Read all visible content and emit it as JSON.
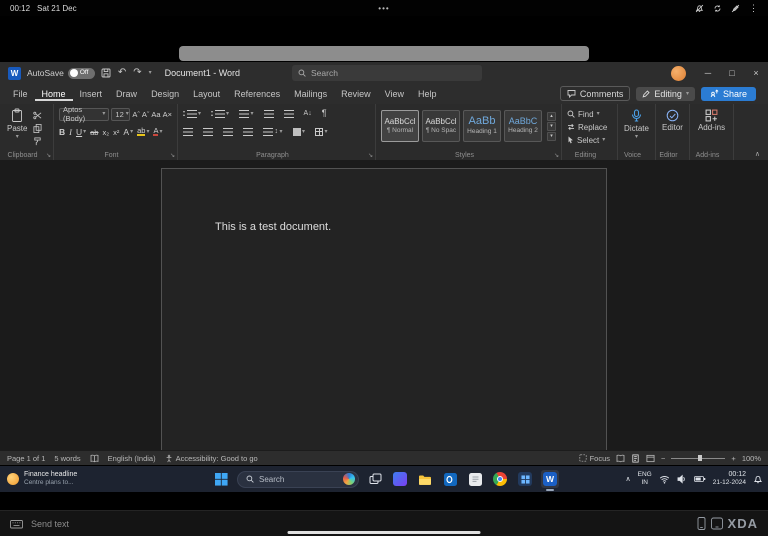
{
  "colors": {
    "share_button": "#2b7cd3",
    "dictate_mic": "#4aa0e8",
    "word_brand": "#185abd",
    "avatar_orange": "#dd7f33",
    "taskbar_bg": "#1d2330",
    "heading_style_blue": "#70a9dc"
  },
  "ui": {
    "chevron_down": "▾",
    "chevron_up": "∧",
    "triangle_up": "▴",
    "launcher": "↘",
    "undo": "↶",
    "redo": "↷",
    "dots_vertical": "⋮",
    "updown": "↕",
    "minus": "−",
    "plus": "+",
    "minimize": "─",
    "maximize": "□",
    "close": "×"
  },
  "android_status": {
    "time": "00:12",
    "date": "Sat 21 Dec",
    "dots": "•••"
  },
  "titlebar": {
    "word_letter": "W",
    "autosave_label": "AutoSave",
    "autosave_state": "Off",
    "title": "Document1 - Word",
    "search_placeholder": "Search"
  },
  "tabs": {
    "items": [
      "File",
      "Home",
      "Insert",
      "Draw",
      "Design",
      "Layout",
      "References",
      "Mailings",
      "Review",
      "View",
      "Help"
    ],
    "active": "Home",
    "comments": "Comments",
    "editing": "Editing",
    "share": "Share"
  },
  "ribbon": {
    "clipboard": {
      "group": "Clipboard",
      "paste": "Paste"
    },
    "font": {
      "group": "Font",
      "family": "Aptos (Body)",
      "size": "12",
      "buttons": {
        "grow": "Aˆ",
        "shrink": "Aˇ",
        "case": "Aa",
        "clear": "A×",
        "bold": "B",
        "italic": "I",
        "underline": "U",
        "strikethrough": "ab",
        "subscript": "x₂",
        "superscript": "x²",
        "effects": "A",
        "highlight": "ab",
        "font_color": "A"
      }
    },
    "paragraph": {
      "group": "Paragraph",
      "pilcrow": "¶",
      "sort": "A↓"
    },
    "styles": {
      "group": "Styles",
      "items": [
        {
          "sample": "AaBbCcl",
          "name": "¶ Normal"
        },
        {
          "sample": "AaBbCcl",
          "name": "¶ No Spac"
        },
        {
          "sample": "AaBb",
          "name": "Heading 1"
        },
        {
          "sample": "AaBbC",
          "name": "Heading 2"
        }
      ]
    },
    "editing": {
      "group": "Editing",
      "find": "Find",
      "replace": "Replace",
      "select": "Select"
    },
    "voice": {
      "group": "Voice",
      "dictate": "Dictate"
    },
    "editor": {
      "group": "Editor",
      "label": "Editor"
    },
    "addins": {
      "group": "Add-ins",
      "label": "Add-ins"
    }
  },
  "document": {
    "body_text": "This is a test document."
  },
  "status": {
    "page": "Page 1 of 1",
    "words": "5 words",
    "language": "English (India)",
    "accessibility": "Accessibility: Good to go",
    "focus": "Focus",
    "zoom": "100%"
  },
  "taskbar": {
    "widget": {
      "title": "Finance headline",
      "subtitle": "Centre plans to..."
    },
    "search_placeholder": "Search",
    "tray": {
      "lang_line1": "ENG",
      "lang_line2": "IN",
      "time": "00:12",
      "date": "21-12-2024"
    }
  },
  "bottom": {
    "send_text_placeholder": "Send text",
    "watermark": "XDA"
  }
}
